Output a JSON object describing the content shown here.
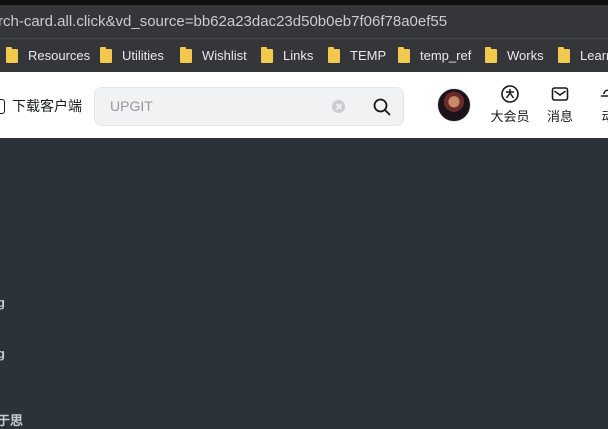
{
  "browser": {
    "url": "rch-card.all.click&vd_source=bb62a23dac23d50b0eb7f06f78a0ef55",
    "bookmarks": [
      {
        "label": "Resources"
      },
      {
        "label": "Utilities"
      },
      {
        "label": "Wishlist"
      },
      {
        "label": "Links"
      },
      {
        "label": "TEMP"
      },
      {
        "label": "temp_ref"
      },
      {
        "label": "Works"
      },
      {
        "label": "Learn"
      }
    ]
  },
  "header": {
    "download_label": "下载客户端",
    "search": {
      "value": "UPGIT"
    },
    "nav": {
      "vip_label": "大会员",
      "messages_label": "消息",
      "dynamics_label": "动"
    }
  },
  "content": {
    "fragments": [
      "g",
      "g",
      "于思"
    ]
  },
  "colors": {
    "page_background": "#2c323a",
    "header_background": "#ffffff",
    "browser_chrome": "#35363a",
    "bookmark_folder": "#f2c94c"
  }
}
